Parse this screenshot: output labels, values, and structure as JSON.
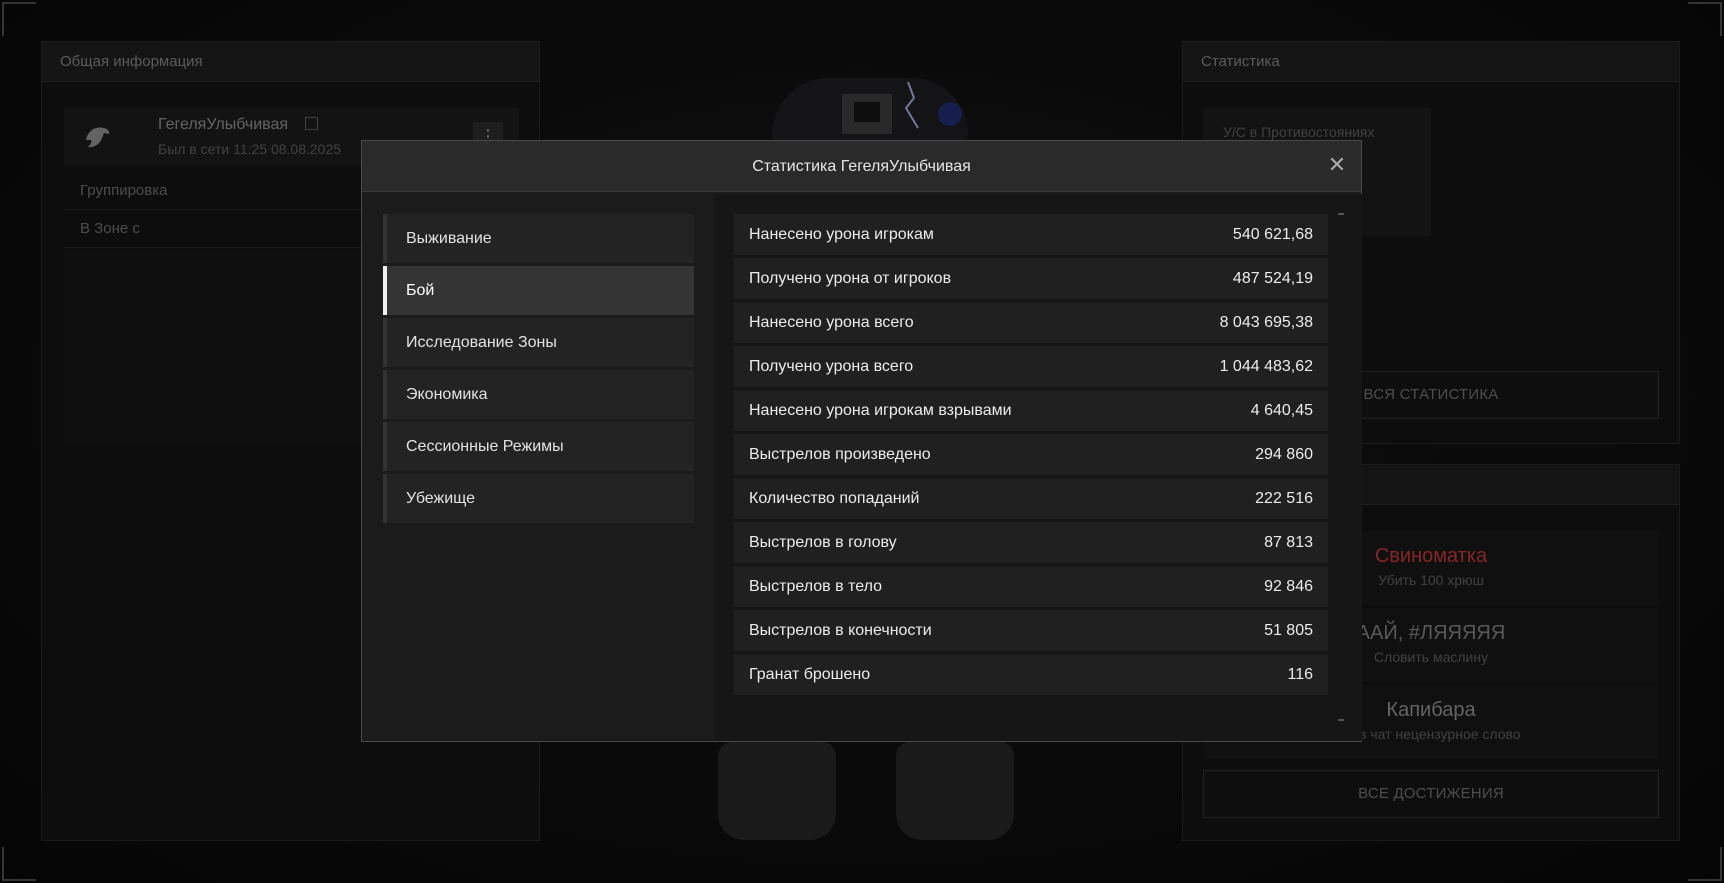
{
  "left_panel": {
    "title": "Общая информация",
    "player_name": "ГегеляУлыбчивая",
    "last_seen": "Был в сети 11:25 08.08.2025",
    "rows": [
      "Группировка",
      "В Зоне с"
    ]
  },
  "right_panel": {
    "title": "Статистика",
    "pvp_label": "У/С в Противостояниях",
    "all_stats_button": "ВСЯ СТАТИСТИКА"
  },
  "achievements": {
    "items": [
      {
        "title": "Свиноматка",
        "desc": "Убить 100 хрюш",
        "color": "#b9343a"
      },
      {
        "title": "ААЙ, #ЛЯЯЯЯЯ",
        "desc": "Словить маслину",
        "color": "#7a7a7a"
      },
      {
        "title": "Капибара",
        "desc": "ть в чат нецензурное слово",
        "color": "#8a8a8a"
      }
    ],
    "all_button": "ВСЕ ДОСТИЖЕНИЯ"
  },
  "modal": {
    "title": "Статистика ГегеляУлыбчивая",
    "close_glyph": "✕",
    "categories": [
      {
        "label": "Выживание",
        "active": false
      },
      {
        "label": "Бой",
        "active": true
      },
      {
        "label": "Исследование Зоны",
        "active": false
      },
      {
        "label": "Экономика",
        "active": false
      },
      {
        "label": "Сессионные Режимы",
        "active": false
      },
      {
        "label": "Убежище",
        "active": false
      }
    ],
    "stats": [
      {
        "label": "Нанесено урона игрокам",
        "value": "540 621,68"
      },
      {
        "label": "Получено урона от игроков",
        "value": "487 524,19"
      },
      {
        "label": "Нанесено урона всего",
        "value": "8 043 695,38"
      },
      {
        "label": "Получено урона всего",
        "value": "1 044 483,62"
      },
      {
        "label": "Нанесено урона игрокам взрывами",
        "value": "4 640,45"
      },
      {
        "label": "Выстрелов произведено",
        "value": "294 860"
      },
      {
        "label": "Количество попаданий",
        "value": "222 516"
      },
      {
        "label": "Выстрелов в голову",
        "value": "87 813"
      },
      {
        "label": "Выстрелов в тело",
        "value": "92 846"
      },
      {
        "label": "Выстрелов в конечности",
        "value": "51 805"
      },
      {
        "label": "Гранат брошено",
        "value": "116"
      }
    ]
  }
}
